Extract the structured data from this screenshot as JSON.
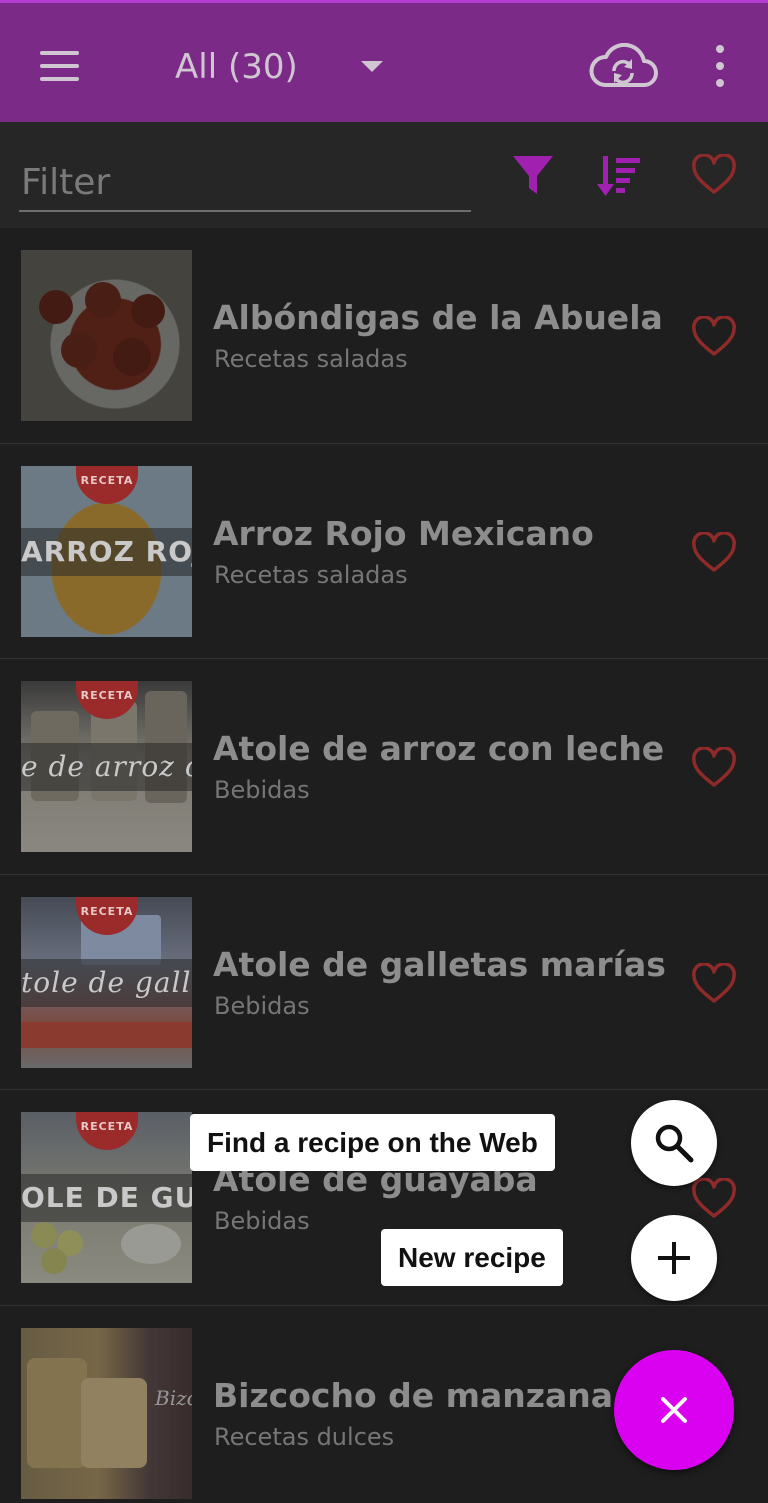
{
  "appbar": {
    "title": "All (30)",
    "icons": [
      "menu-icon",
      "dropdown-arrow-icon",
      "cloud-sync-icon",
      "more-vertical-icon"
    ],
    "background": "#7b2a87"
  },
  "filterbar": {
    "placeholder": "Filter",
    "icons": [
      "filter-icon",
      "sort-icon",
      "favorites-heart-icon"
    ],
    "accent": "#a020b0"
  },
  "recipes": [
    {
      "title": "Albóndigas de la Abuela",
      "category": "Recetas saladas",
      "thumb_text": "",
      "tag": ""
    },
    {
      "title": "Arroz Rojo Mexicano",
      "category": "Recetas saladas",
      "thumb_text": "ARROZ ROJO",
      "tag": "RECETA"
    },
    {
      "title": "Atole de arroz con leche",
      "category": "Bebidas",
      "thumb_text": "e de arroz con l",
      "tag": "RECETA"
    },
    {
      "title": "Atole de galletas marías",
      "category": "Bebidas",
      "thumb_text": "tole de galleta",
      "tag": "RECETA"
    },
    {
      "title": "Atole de guayaba",
      "category": "Bebidas",
      "thumb_text": "OLE DE GUAYA",
      "tag": "RECETA"
    },
    {
      "title": "Bizcocho de manzana",
      "category": "Recetas dulces",
      "thumb_text": "Bizc",
      "tag": ""
    }
  ],
  "fab_menu": {
    "find_label": "Find a recipe on the Web",
    "new_label": "New recipe",
    "icons": [
      "search-icon",
      "plus-icon",
      "close-icon"
    ],
    "fab_color": "#da00f0"
  },
  "colors": {
    "heart": "#8e2a2a",
    "background": "#1e1e1e"
  }
}
